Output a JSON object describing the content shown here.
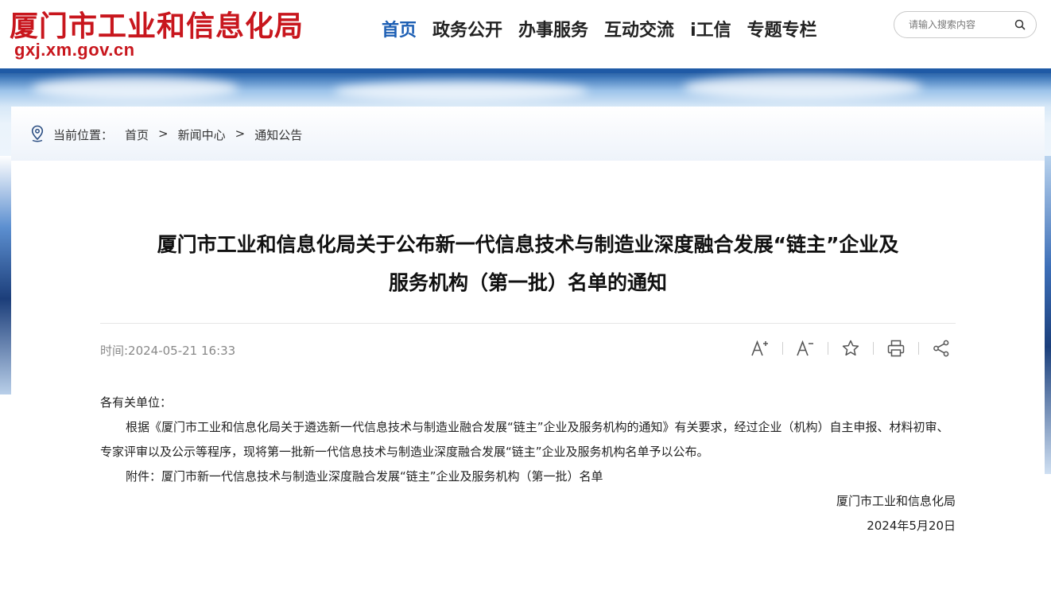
{
  "header": {
    "site_title": "厦门市工业和信息化局",
    "domain": "gxj.xm.gov.cn",
    "nav": [
      "首页",
      "政务公开",
      "办事服务",
      "互动交流",
      "i工信",
      "专题专栏"
    ],
    "search_placeholder": "请输入搜索内容"
  },
  "breadcrumb": {
    "label": "当前位置：",
    "items": [
      "首页",
      "新闻中心",
      "通知公告"
    ],
    "separator": ">"
  },
  "article": {
    "title_line1": "厦门市工业和信息化局关于公布新一代信息技术与制造业深度融合发展“链主”企业及",
    "title_line2": "服务机构（第一批）名单的通知",
    "time": "时间:2024-05-21 16:33",
    "tools": [
      "font-increase-icon",
      "font-decrease-icon",
      "star-icon",
      "printer-icon",
      "share-icon"
    ],
    "salutation": "各有关单位：",
    "paragraph1": "根据《厦门市工业和信息化局关于遴选新一代信息技术与制造业融合发展“链主”企业及服务机构的通知》有关要求，经过企业（机构）自主申报、材料初审、专家评审以及公示等程序，现将第一批新一代信息技术与制造业深度融合发展“链主”企业及服务机构名单予以公布。",
    "attachment": "附件：厦门市新一代信息技术与制造业深度融合发展“链主”企业及服务机构（第一批）名单",
    "signature": "厦门市工业和信息化局",
    "date": "2024年5月20日"
  },
  "colors": {
    "brand_red": "#c8161d",
    "nav_active": "#1d5fb4",
    "banner_blue": "#1f5aa6"
  }
}
